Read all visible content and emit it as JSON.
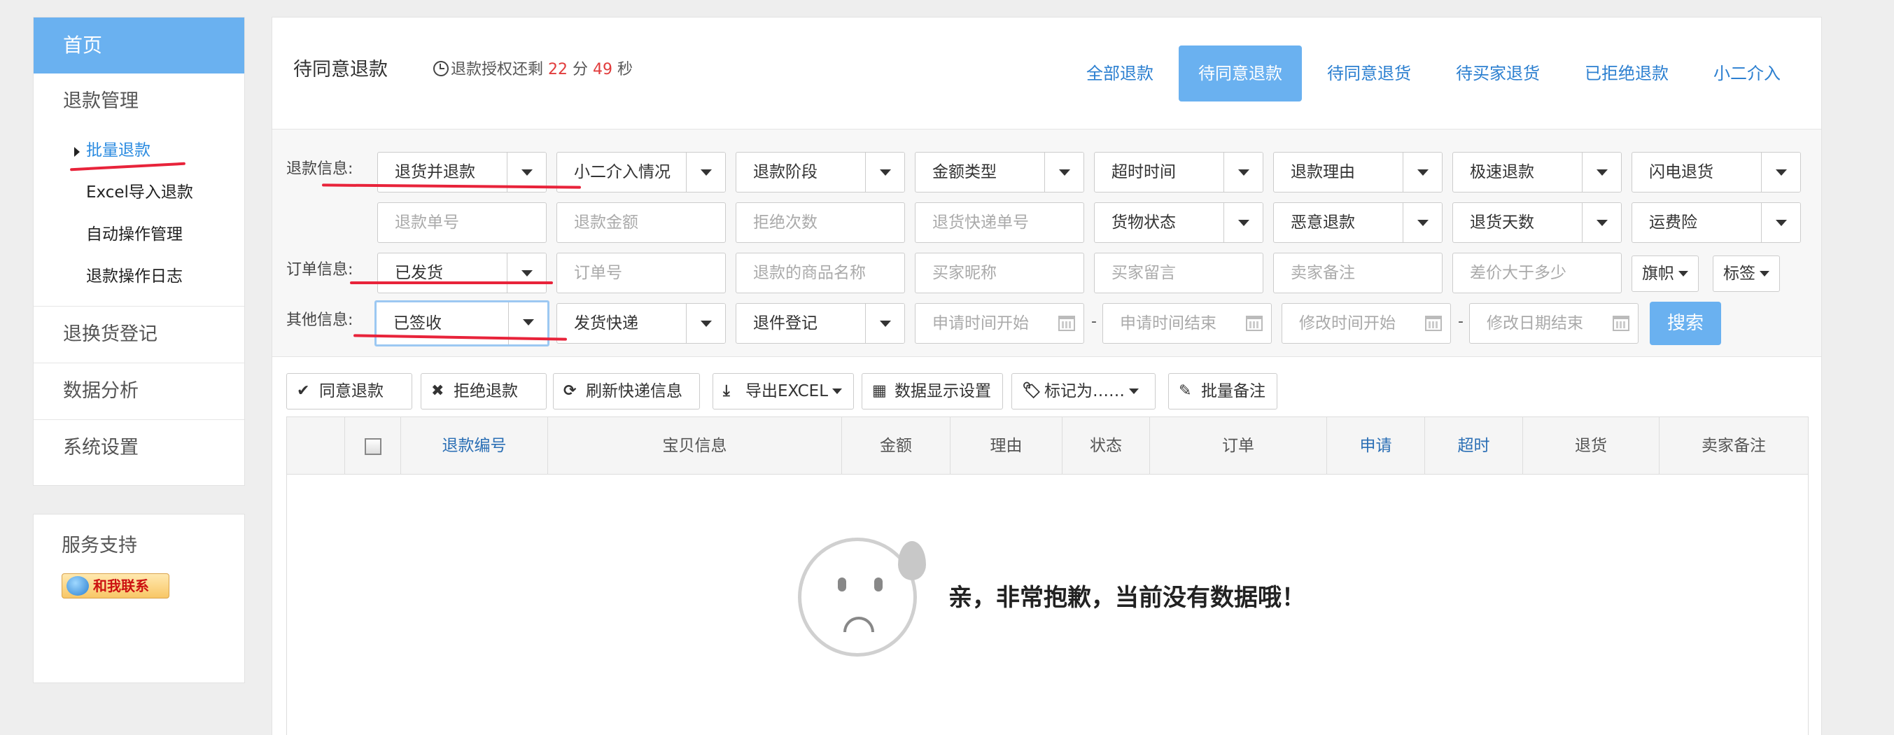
{
  "sidebar": {
    "home": "首页",
    "refund_mgmt": "退款管理",
    "sub_items": [
      "批量退款",
      "Excel导入退款",
      "自动操作管理",
      "退款操作日志"
    ],
    "return_reg": "退换货登记",
    "data_analysis": "数据分析",
    "system_settings": "系统设置"
  },
  "support": {
    "title": "服务支持",
    "contact": "和我联系"
  },
  "header": {
    "title": "待同意退款",
    "countdown_prefix": "退款授权还剩",
    "minutes": "22",
    "min_unit": "分",
    "seconds": "49",
    "sec_unit": "秒",
    "tabs": [
      "全部退款",
      "待同意退款",
      "待同意退货",
      "待买家退货",
      "已拒绝退款",
      "小二介入"
    ],
    "active_tab": "待同意退款"
  },
  "filters": {
    "labels": {
      "refund": "退款信息:",
      "order": "订单信息:",
      "other": "其他信息:"
    },
    "row1": [
      "退货并退款",
      "小二介入情况",
      "退款阶段",
      "金额类型",
      "超时时间",
      "退款理由",
      "极速退款",
      "闪电退货"
    ],
    "row2_inputs": [
      "退款单号",
      "退款金额",
      "拒绝次数",
      "退货快递单号"
    ],
    "row2_selects": [
      "货物状态",
      "恶意退款",
      "退货天数",
      "运费险"
    ],
    "row3_select": "已发货",
    "row3_inputs": [
      "订单号",
      "退款的商品名称",
      "买家昵称",
      "买家留言",
      "卖家备注",
      "差价大于多少"
    ],
    "row3_dd": [
      "旗帜",
      "标签"
    ],
    "row4_selects": [
      "已签收",
      "发货快递",
      "退件登记"
    ],
    "row4_dates": [
      "申请时间开始",
      "申请时间结束",
      "修改时间开始",
      "修改日期结束"
    ],
    "dash": "-",
    "search": "搜索"
  },
  "toolbar": {
    "agree": "同意退款",
    "reject": "拒绝退款",
    "refresh": "刷新快递信息",
    "export": "导出EXCEL",
    "display": "数据显示设置",
    "mark": "标记为……",
    "note": "批量备注"
  },
  "table": {
    "columns": [
      "退款编号",
      "宝贝信息",
      "金额",
      "理由",
      "状态",
      "订单",
      "申请",
      "超时",
      "退货",
      "卖家备注"
    ],
    "empty_message": "亲，非常抱歉，当前没有数据哦！"
  },
  "colors": {
    "accent": "#6ab1f0",
    "link": "#2b7fd0",
    "annotation": "#e8233a",
    "countdown": "#e13c3c"
  }
}
